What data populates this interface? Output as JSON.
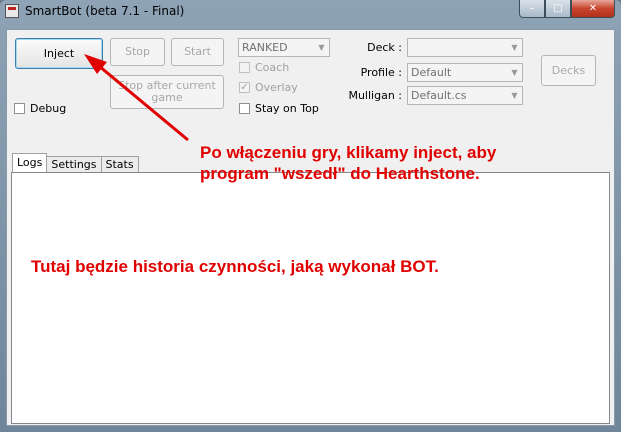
{
  "window": {
    "title": "SmartBot (beta 7.1 - Final)",
    "minimize_glyph": "–",
    "maximize_glyph": "□",
    "close_glyph": "✕"
  },
  "toolbar": {
    "inject": "Inject",
    "stop": "Stop",
    "start": "Start",
    "stop_after_game": "Stop after current game",
    "decks": "Decks"
  },
  "debug_label": "Debug",
  "mode": {
    "selected": "RANKED"
  },
  "options": {
    "coach": "Coach",
    "overlay": "Overlay",
    "stay_on_top": "Stay on Top"
  },
  "fields": {
    "deck": {
      "label": "Deck :",
      "value": ""
    },
    "profile": {
      "label": "Profile :",
      "value": "Default"
    },
    "mulligan": {
      "label": "Mulligan :",
      "value": "Default.cs"
    }
  },
  "tabs": [
    "Logs",
    "Settings",
    "Stats"
  ],
  "annotations": {
    "inject_note": [
      "Po włączeniu gry, klikamy inject, aby",
      "program \"wszedł\" do Hearthstone."
    ],
    "log_note": "Tutaj będzie historia czynności, jaką wykonał BOT."
  },
  "colors": {
    "annotation": "#e10000"
  }
}
